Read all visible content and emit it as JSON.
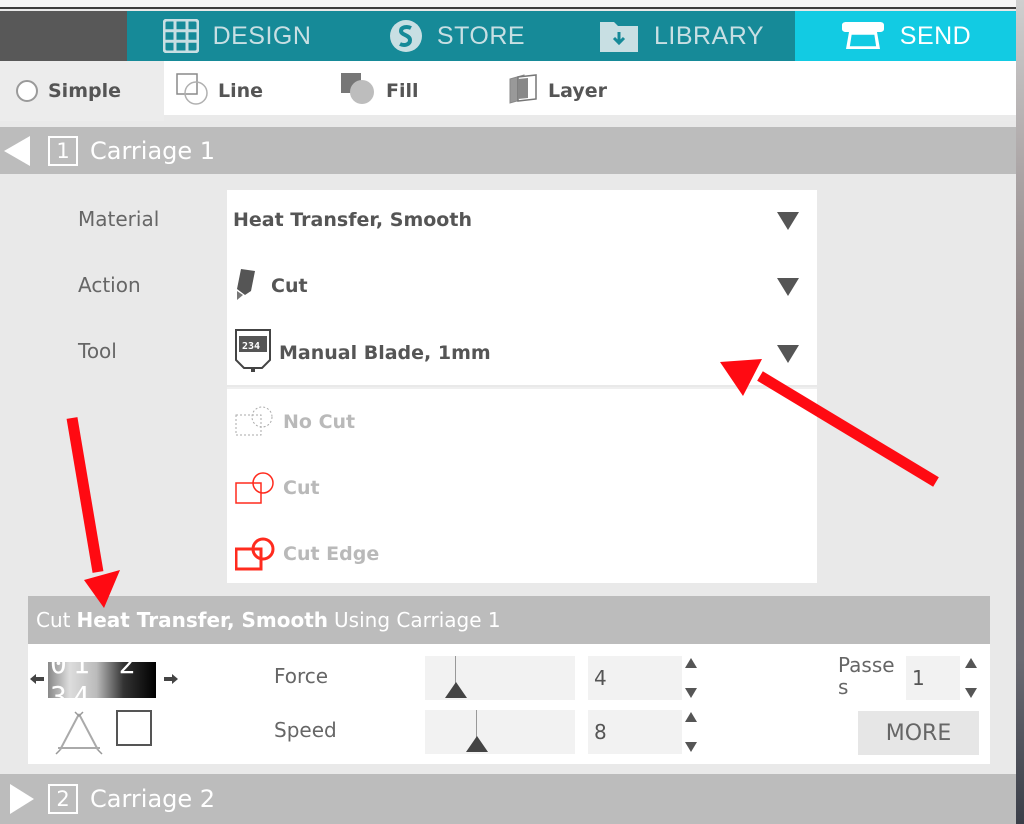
{
  "nav": {
    "tabs": [
      {
        "label": "DESIGN",
        "icon": "grid-icon",
        "active": false
      },
      {
        "label": "STORE",
        "icon": "silhouette-s-icon",
        "active": false
      },
      {
        "label": "LIBRARY",
        "icon": "folder-download-icon",
        "active": false
      },
      {
        "label": "SEND",
        "icon": "cutter-machine-icon",
        "active": true
      }
    ],
    "colors": {
      "tab_bg": "#168a98",
      "active_bg": "#12cbe3"
    }
  },
  "modes": [
    {
      "label": "Simple",
      "icon": "radio-icon",
      "selected": true
    },
    {
      "label": "Line",
      "icon": "line-mode-icon"
    },
    {
      "label": "Fill",
      "icon": "fill-mode-icon"
    },
    {
      "label": "Layer",
      "icon": "layer-mode-icon"
    }
  ],
  "carriage1": {
    "number": "1",
    "title": "Carriage 1",
    "expanded": true,
    "fields": {
      "material_label": "Material",
      "material_value": "Heat Transfer, Smooth",
      "action_label": "Action",
      "action_value": "Cut",
      "tool_label": "Tool",
      "tool_value": "Manual Blade, 1mm"
    },
    "action_options": [
      {
        "label": "No Cut",
        "icon": "no-cut-icon"
      },
      {
        "label": "Cut",
        "icon": "cut-icon"
      },
      {
        "label": "Cut Edge",
        "icon": "cut-edge-icon"
      }
    ]
  },
  "summary": {
    "prefix": "Cut",
    "material": "Heat Transfer, Smooth",
    "suffix": "Using Carriage 1"
  },
  "settings": {
    "blade_dial": "01 2 34",
    "force_label": "Force",
    "force_value": "4",
    "force_slider_fraction": 0.13,
    "speed_label": "Speed",
    "speed_value": "8",
    "speed_slider_fraction": 0.27,
    "passes_label": "Passe s",
    "passes_label_line1": "Passe",
    "passes_label_line2": "s",
    "passes_value": "1",
    "more_label": "MORE"
  },
  "carriage2": {
    "number": "2",
    "title": "Carriage 2",
    "expanded": false
  },
  "annotation_color": "#ff0a12"
}
